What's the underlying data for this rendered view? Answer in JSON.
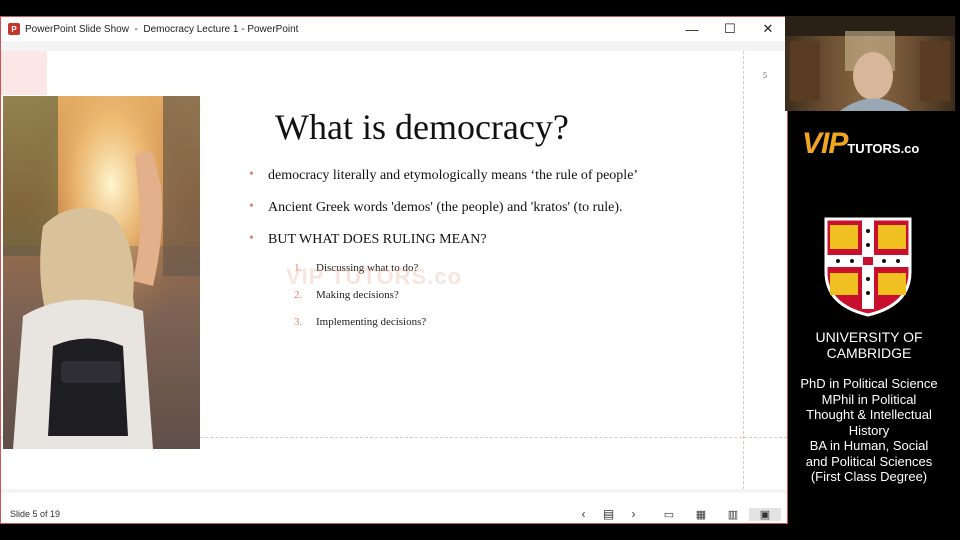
{
  "window": {
    "app_icon": "P",
    "title": "PowerPoint Slide Show  -  Democracy Lecture 1 - PowerPoint",
    "controls": {
      "minimize": "—",
      "maximize": "☐",
      "close": "✕"
    }
  },
  "slide": {
    "number": "5",
    "title": "What is democracy?",
    "bullets": [
      "democracy literally and etymologically means ‘the rule of people’",
      "Ancient Greek words 'demos' (the people) and 'kratos' (to rule).",
      "BUT WHAT DOES RULING MEAN?"
    ],
    "subitems": [
      {
        "num": "1.",
        "text": "Discussing what to do?"
      },
      {
        "num": "2.",
        "text": "Making decisions?"
      },
      {
        "num": "3.",
        "text": "Implementing decisions?"
      }
    ],
    "watermark": "VIP TUTORS.co"
  },
  "statusbar": {
    "slide_counter": "Slide 5 of 19",
    "nav": {
      "prev": "‹",
      "menu": "▤",
      "next": "›"
    },
    "views": {
      "normal": "▭",
      "sorter": "▦",
      "reading": "▥",
      "slideshow": "▣"
    }
  },
  "sidebar": {
    "logo": {
      "vip": "VIP",
      "tutors": "TUTORS.co"
    },
    "university": [
      "UNIVERSITY OF",
      "CAMBRIDGE"
    ],
    "degrees": [
      "PhD in Political Science",
      "MPhil in Political",
      "Thought & Intellectual",
      "History",
      "BA in Human, Social",
      "and Political Sciences",
      "(First Class Degree)"
    ]
  },
  "colors": {
    "accent": "#d8866e",
    "logo_gold": "#f0a622",
    "crest_red": "#c8102e"
  }
}
